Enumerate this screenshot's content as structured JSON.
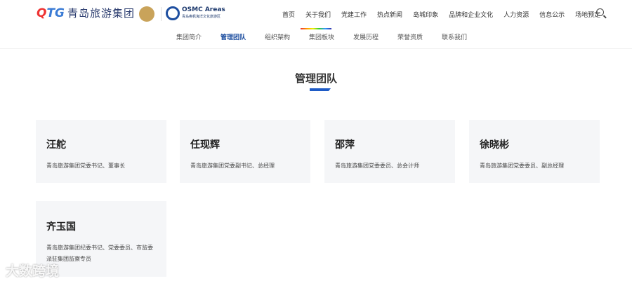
{
  "logo": {
    "mark": "QTG",
    "name": "青岛旅游集团",
    "partner": "OSMC Areas",
    "partner_sub": "青岛奥帆海洋文化旅游区"
  },
  "nav": [
    "首页",
    "关于我们",
    "党建工作",
    "热点新闻",
    "岛城印象",
    "品牌和企业文化",
    "人力资源",
    "信息公示",
    "场地预定"
  ],
  "subnav": [
    "集团简介",
    "管理团队",
    "组织架构",
    "集团板块",
    "发展历程",
    "荣誉资质",
    "联系我们"
  ],
  "title": "管理团队",
  "members": [
    {
      "name": "汪舵",
      "role": "青岛旅游集团党委书记、董事长"
    },
    {
      "name": "任现辉",
      "role": "青岛旅游集团党委副书记、总经理"
    },
    {
      "name": "邵萍",
      "role": "青岛旅游集团党委委员、总会计师"
    },
    {
      "name": "徐晓彬",
      "role": "青岛旅游集团党委委员、副总经理"
    },
    {
      "name": "齐玉国",
      "role": "青岛旅游集团纪委书记、党委委员、市监委派驻集团监察专员"
    }
  ],
  "watermark": "大数跨境"
}
